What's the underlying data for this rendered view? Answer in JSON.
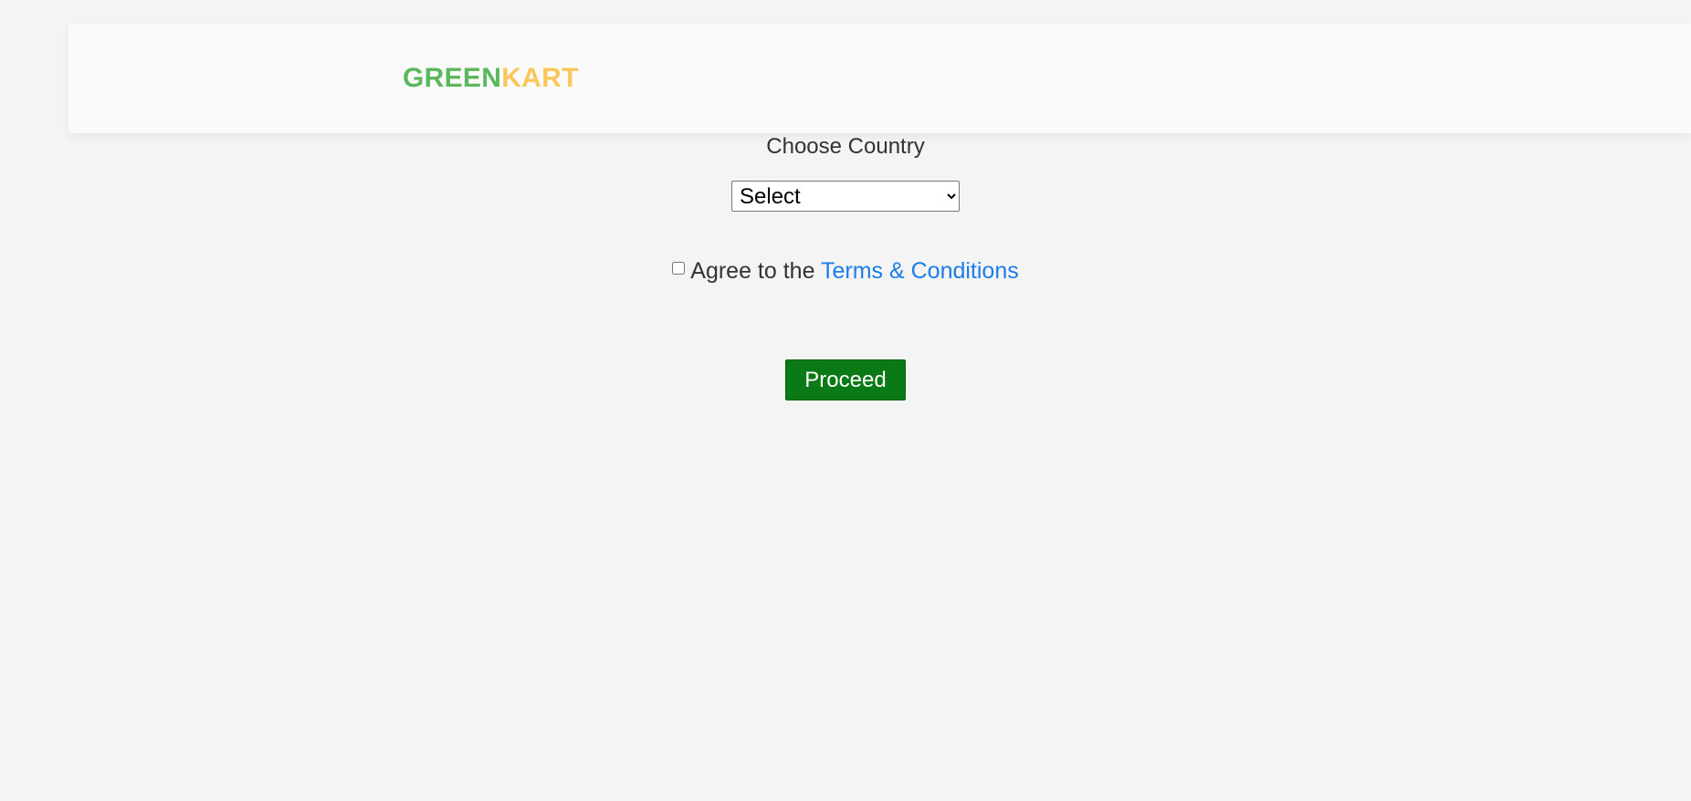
{
  "header": {
    "logo_part1": "GREEN",
    "logo_part2": "KART",
    "logo_colors": {
      "green": "#5cb85c",
      "kart": "#fbc75b"
    }
  },
  "form": {
    "choose_label": "Choose Country",
    "country_select": {
      "selected": "Select",
      "options": [
        "Select"
      ]
    },
    "agree_text": "Agree to the",
    "terms_link": "Terms & Conditions",
    "agree_checked": false,
    "proceed_label": "Proceed"
  },
  "colors": {
    "background": "#f4f4f4",
    "header_background": "#fafafa",
    "link": "#1a7de8",
    "button": "#0a7a16"
  }
}
